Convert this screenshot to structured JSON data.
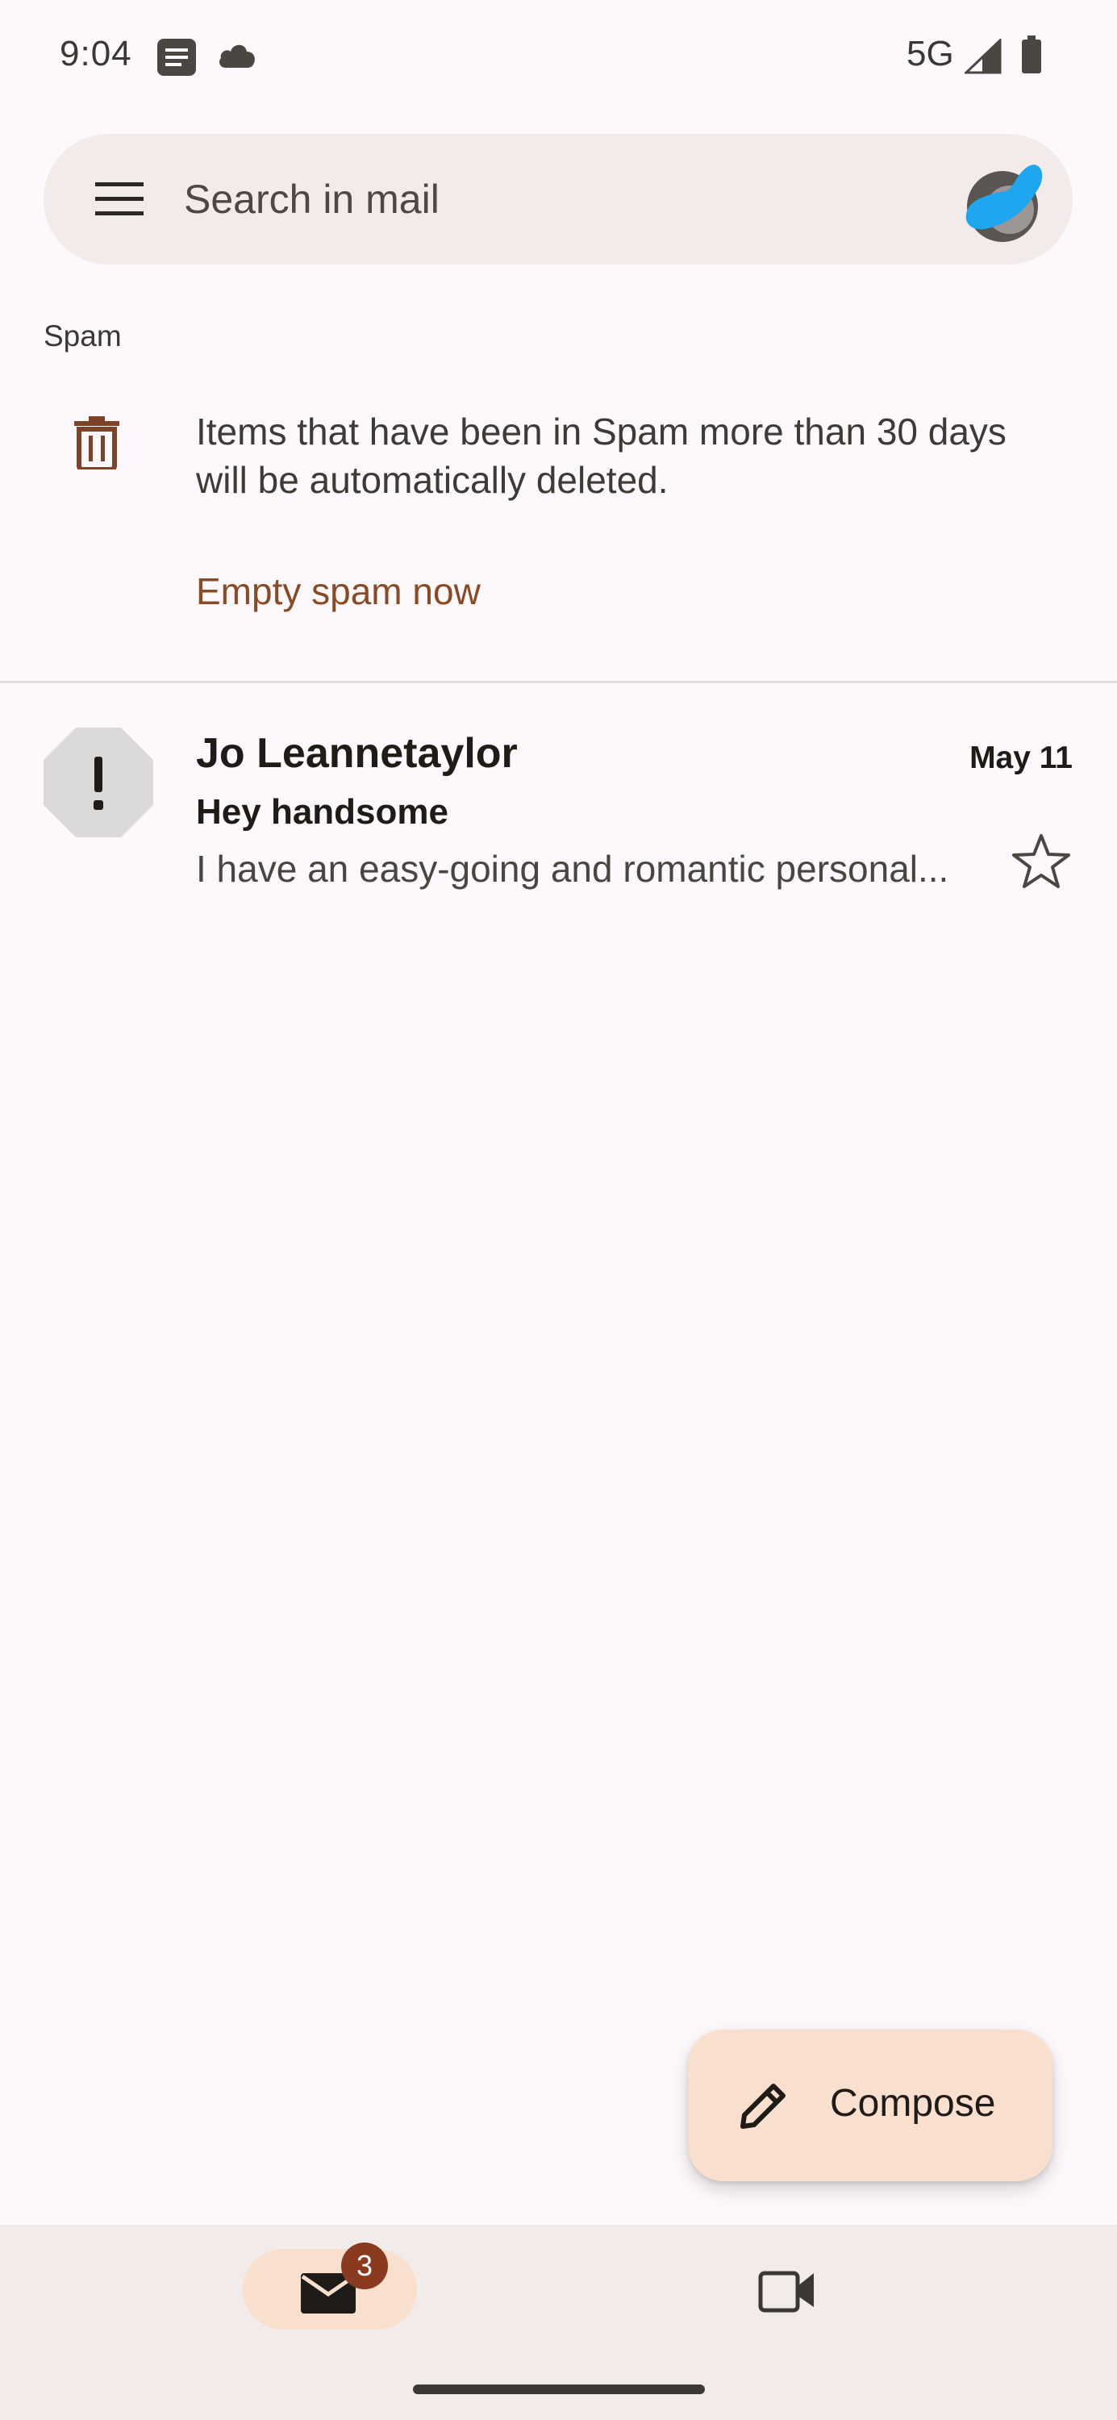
{
  "status_bar": {
    "time": "9:04",
    "network": "5G",
    "icons": [
      "message-icon",
      "cloud-icon",
      "signal-icon",
      "battery-icon"
    ]
  },
  "search": {
    "placeholder": "Search in mail",
    "menu_icon": "menu-icon",
    "avatar_icon": "account-avatar"
  },
  "folder": {
    "label": "Spam",
    "notice": "Items that have been in Spam more than 30 days will be automatically deleted.",
    "empty_action": "Empty spam now",
    "notice_icon": "trash-icon"
  },
  "emails": [
    {
      "sender": "Jo Leannetaylor",
      "date": "May 11",
      "subject": "Hey handsome",
      "snippet": "I have an easy-going and romantic personal...",
      "avatar_icon": "spam-warning-icon",
      "starred": false
    }
  ],
  "compose": {
    "label": "Compose",
    "icon": "pencil-icon"
  },
  "bottom_nav": {
    "mail": {
      "icon": "mail-icon",
      "badge": "3",
      "selected": true
    },
    "meet": {
      "icon": "video-icon",
      "selected": false
    }
  },
  "colors": {
    "background": "#fdf8fb",
    "surface": "#f2ebe9",
    "accent_text": "#8a4b24",
    "fab": "#f9dfcd",
    "badge": "#8a3a1e"
  }
}
